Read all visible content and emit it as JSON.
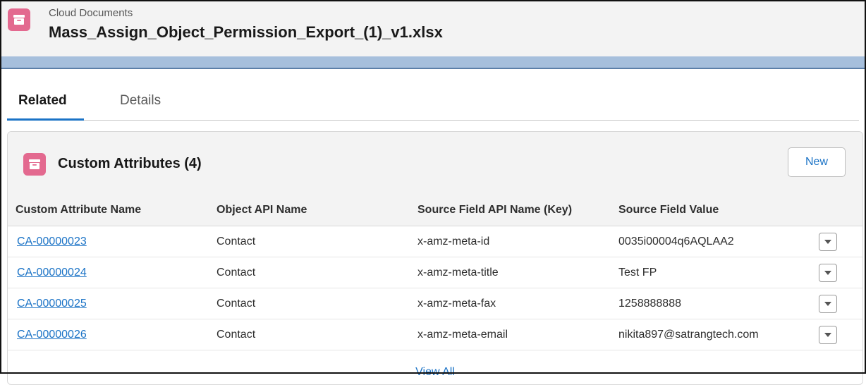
{
  "header": {
    "object_label": "Cloud Documents",
    "record_title": "Mass_Assign_Object_Permission_Export_(1)_v1.xlsx",
    "icon": "file-box-icon"
  },
  "tabs": [
    {
      "label": "Related",
      "active": true
    },
    {
      "label": "Details",
      "active": false
    }
  ],
  "related_list": {
    "title": "Custom Attributes (4)",
    "icon": "file-box-icon",
    "new_button": "New",
    "columns": [
      "Custom Attribute Name",
      "Object API Name",
      "Source Field API Name (Key)",
      "Source Field Value"
    ],
    "rows": [
      {
        "name": "CA-00000023",
        "object": "Contact",
        "key": "x-amz-meta-id",
        "value": "0035i00004q6AQLAA2"
      },
      {
        "name": "CA-00000024",
        "object": "Contact",
        "key": "x-amz-meta-title",
        "value": "Test FP"
      },
      {
        "name": "CA-00000025",
        "object": "Contact",
        "key": "x-amz-meta-fax",
        "value": "1258888888"
      },
      {
        "name": "CA-00000026",
        "object": "Contact",
        "key": "x-amz-meta-email",
        "value": "nikita897@satrangtech.com"
      }
    ],
    "view_all": "View All"
  },
  "colors": {
    "accent": "#1b73c6",
    "icon_bg": "#e3698f",
    "band": "#a6bfdc"
  }
}
